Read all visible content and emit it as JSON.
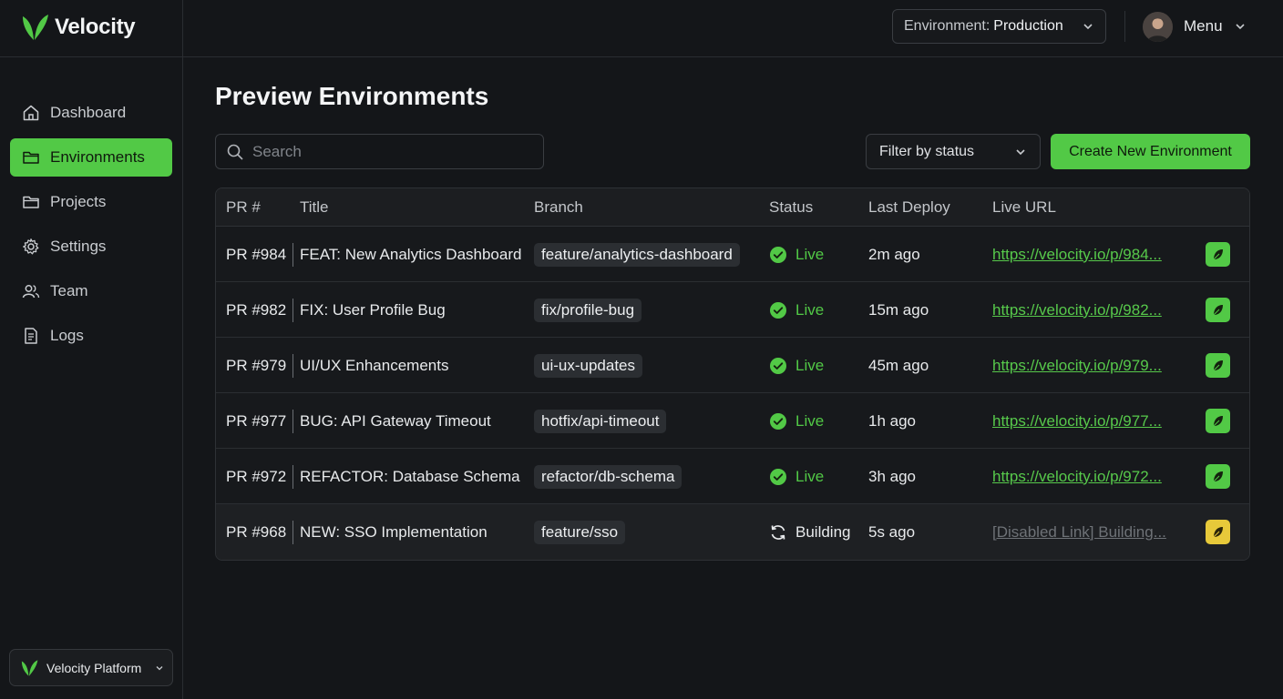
{
  "app": {
    "name": "Velocity"
  },
  "header": {
    "environment_label": "Environment:",
    "environment_value": "Production",
    "menu_label": "Menu"
  },
  "sidebar": {
    "items": [
      {
        "label": "Dashboard",
        "icon": "home-icon",
        "active": false
      },
      {
        "label": "Environments",
        "icon": "folder-icon",
        "active": true
      },
      {
        "label": "Projects",
        "icon": "folder-icon",
        "active": false
      },
      {
        "label": "Settings",
        "icon": "gear-icon",
        "active": false
      },
      {
        "label": "Team",
        "icon": "users-icon",
        "active": false
      },
      {
        "label": "Logs",
        "icon": "document-icon",
        "active": false
      }
    ],
    "platform_label": "Velocity Platform"
  },
  "main": {
    "title": "Preview Environments",
    "search_placeholder": "Search",
    "filter_label": "Filter by status",
    "create_button": "Create New Environment",
    "columns": [
      "PR #",
      "Title",
      "Branch",
      "Status",
      "Last Deploy",
      "Live URL"
    ],
    "rows": [
      {
        "pr": "PR #984",
        "title": "FEAT: New Analytics Dashboard",
        "branch": "feature/analytics-dashboard",
        "status": "Live",
        "last_deploy": "2m ago",
        "url": "https://velocity.io/p/984..."
      },
      {
        "pr": "PR #982",
        "title": "FIX: User Profile Bug",
        "branch": "fix/profile-bug",
        "status": "Live",
        "last_deploy": "15m ago",
        "url": "https://velocity.io/p/982..."
      },
      {
        "pr": "PR #979",
        "title": "UI/UX Enhancements",
        "branch": "ui-ux-updates",
        "status": "Live",
        "last_deploy": "45m ago",
        "url": "https://velocity.io/p/979..."
      },
      {
        "pr": "PR #977",
        "title": "BUG: API Gateway Timeout",
        "branch": "hotfix/api-timeout",
        "status": "Live",
        "last_deploy": "1h ago",
        "url": "https://velocity.io/p/977..."
      },
      {
        "pr": "PR #972",
        "title": "REFACTOR: Database Schema",
        "branch": "refactor/db-schema",
        "status": "Live",
        "last_deploy": "3h ago",
        "url": "https://velocity.io/p/972..."
      },
      {
        "pr": "PR #968",
        "title": "NEW: SSO Implementation",
        "branch": "feature/sso",
        "status": "Building",
        "last_deploy": "5s ago",
        "url": "[Disabled Link] Building..."
      }
    ]
  },
  "colors": {
    "accent": "#52c946",
    "warning": "#e7c93a",
    "background": "#141619"
  }
}
